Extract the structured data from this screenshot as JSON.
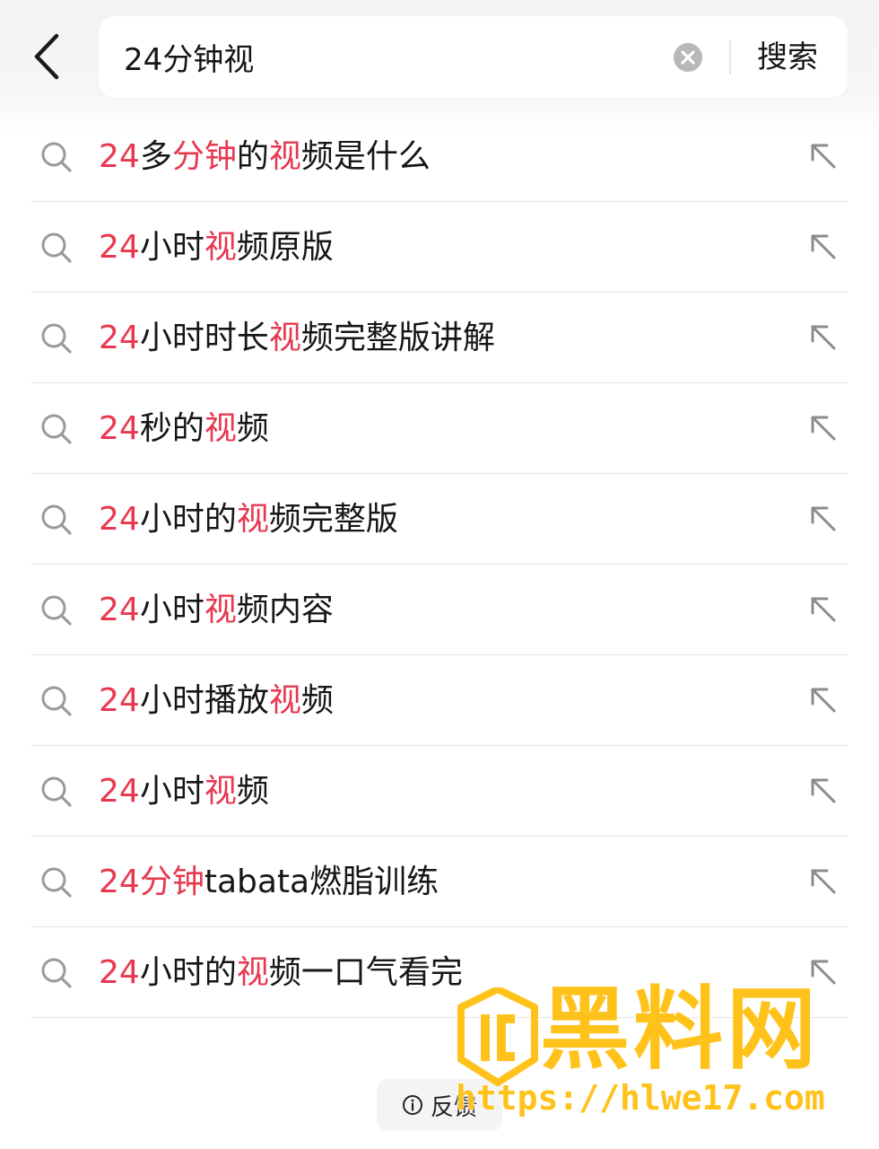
{
  "search": {
    "query": "24分钟视",
    "submit_label": "搜索"
  },
  "suggestions": [
    {
      "parts": [
        {
          "t": "24",
          "hl": true
        },
        {
          "t": "多",
          "hl": false
        },
        {
          "t": "分钟",
          "hl": true
        },
        {
          "t": "的",
          "hl": false
        },
        {
          "t": "视",
          "hl": true
        },
        {
          "t": "频是什么",
          "hl": false
        }
      ]
    },
    {
      "parts": [
        {
          "t": "24",
          "hl": true
        },
        {
          "t": "小时",
          "hl": false
        },
        {
          "t": "视",
          "hl": true
        },
        {
          "t": "频原版",
          "hl": false
        }
      ]
    },
    {
      "parts": [
        {
          "t": "24",
          "hl": true
        },
        {
          "t": "小时时长",
          "hl": false
        },
        {
          "t": "视",
          "hl": true
        },
        {
          "t": "频完整版讲解",
          "hl": false
        }
      ]
    },
    {
      "parts": [
        {
          "t": "24",
          "hl": true
        },
        {
          "t": "秒的",
          "hl": false
        },
        {
          "t": "视",
          "hl": true
        },
        {
          "t": "频",
          "hl": false
        }
      ]
    },
    {
      "parts": [
        {
          "t": "24",
          "hl": true
        },
        {
          "t": "小时的",
          "hl": false
        },
        {
          "t": "视",
          "hl": true
        },
        {
          "t": "频完整版",
          "hl": false
        }
      ]
    },
    {
      "parts": [
        {
          "t": "24",
          "hl": true
        },
        {
          "t": "小时",
          "hl": false
        },
        {
          "t": "视",
          "hl": true
        },
        {
          "t": "频内容",
          "hl": false
        }
      ]
    },
    {
      "parts": [
        {
          "t": "24",
          "hl": true
        },
        {
          "t": "小时播放",
          "hl": false
        },
        {
          "t": "视",
          "hl": true
        },
        {
          "t": "频",
          "hl": false
        }
      ]
    },
    {
      "parts": [
        {
          "t": "24",
          "hl": true
        },
        {
          "t": "小时",
          "hl": false
        },
        {
          "t": "视",
          "hl": true
        },
        {
          "t": "频",
          "hl": false
        }
      ]
    },
    {
      "parts": [
        {
          "t": "24",
          "hl": true
        },
        {
          "t": "分钟",
          "hl": true
        },
        {
          "t": "tabata燃脂训练",
          "hl": false
        }
      ]
    },
    {
      "parts": [
        {
          "t": "24",
          "hl": true
        },
        {
          "t": "小时的",
          "hl": false
        },
        {
          "t": "视",
          "hl": true
        },
        {
          "t": "频一口气看完",
          "hl": false
        }
      ]
    }
  ],
  "feedback": {
    "label": "反馈"
  },
  "watermark": {
    "title": "黑料网",
    "url": "https://hlwe17.com"
  },
  "colors": {
    "highlight": "#e8384f",
    "text": "#161616",
    "watermark": "#ffc21a"
  },
  "icons": {
    "back": "chevron-left-icon",
    "clear": "clear-circle-icon",
    "row_search": "search-icon",
    "row_fill": "arrow-up-left-icon",
    "feedback": "info-icon"
  }
}
